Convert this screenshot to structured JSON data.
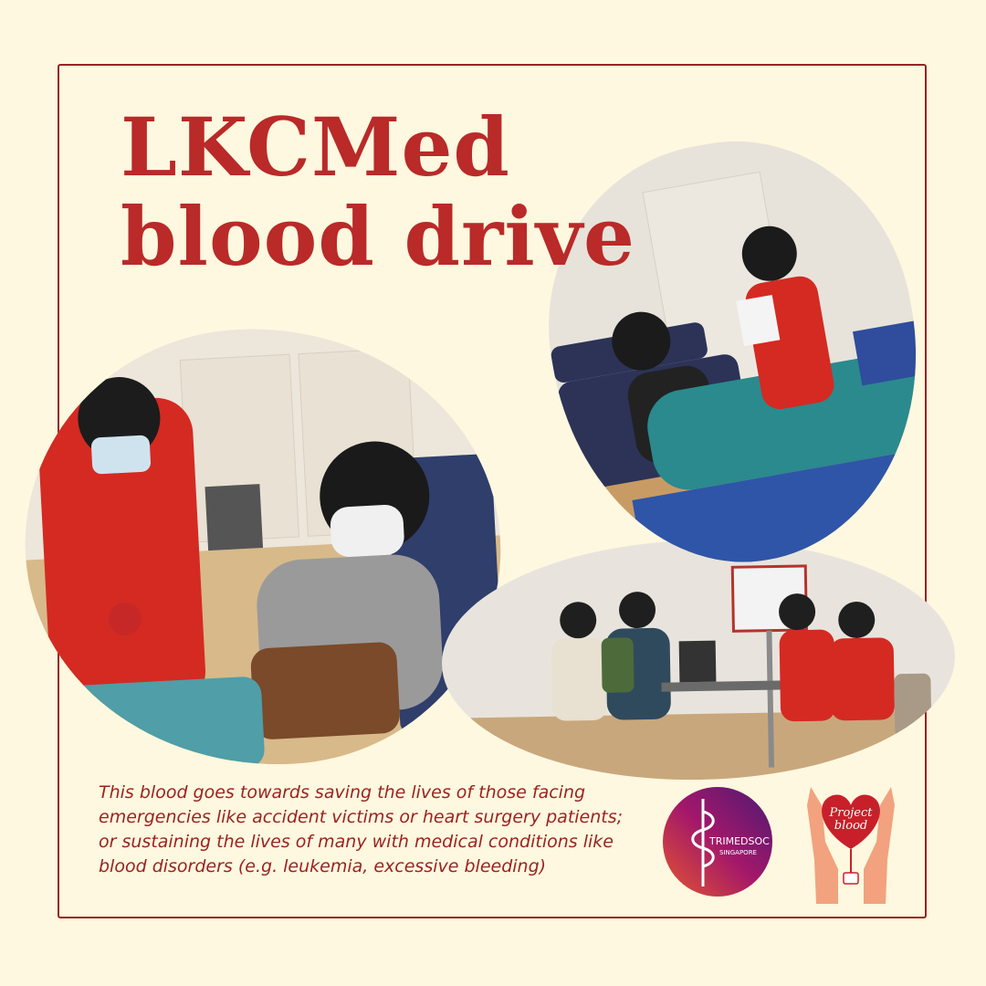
{
  "title": {
    "line1": "LKCMed",
    "line2": "blood drive"
  },
  "caption": {
    "line1": "This blood goes towards saving the lives of those facing",
    "line2": "emergencies like accident victims or heart surgery patients;",
    "line3": "or sustaining the lives of many with medical conditions like",
    "line4": "blood disorders (e.g. leukemia, excessive bleeding)"
  },
  "logos": {
    "trimedsoc": {
      "name": "TRIMEDSOC",
      "sub": "SINGAPORE"
    },
    "project_blood": {
      "line1": "Project",
      "line2": "blood"
    }
  },
  "colors": {
    "background": "#fdf8df",
    "accent": "#b92a29",
    "border": "#9b2222"
  }
}
